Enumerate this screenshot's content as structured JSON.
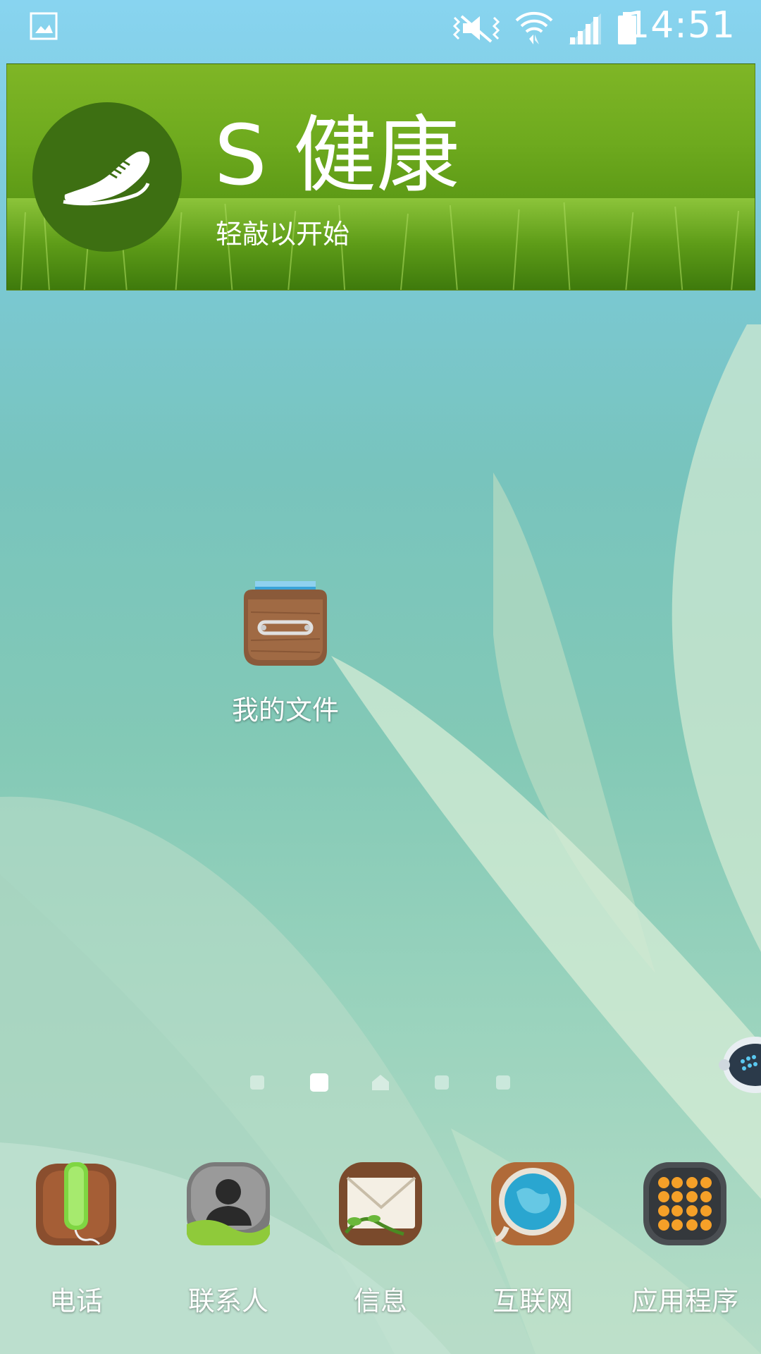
{
  "status_bar": {
    "time": "14:51",
    "icons": [
      "gallery-notification-icon",
      "vibrate-mute-icon",
      "wifi-icon",
      "signal-icon",
      "battery-icon"
    ]
  },
  "widget": {
    "title": "S 健康",
    "subtitle": "轻敲以开始",
    "icon": "shoe-icon"
  },
  "desktop_apps": [
    {
      "label": "我的文件",
      "icon": "my-files-icon"
    }
  ],
  "page_indicator": {
    "total_pages": 5,
    "current_page": 2,
    "home_page": 3
  },
  "dock": [
    {
      "label": "电话",
      "icon": "phone-icon"
    },
    {
      "label": "联系人",
      "icon": "contacts-icon"
    },
    {
      "label": "信息",
      "icon": "messages-icon"
    },
    {
      "label": "互联网",
      "icon": "internet-icon"
    },
    {
      "label": "应用程序",
      "icon": "apps-icon"
    }
  ],
  "colors": {
    "widget_green": "#6eaa1e",
    "widget_circle": "#3d6f12",
    "text": "#ffffff"
  }
}
